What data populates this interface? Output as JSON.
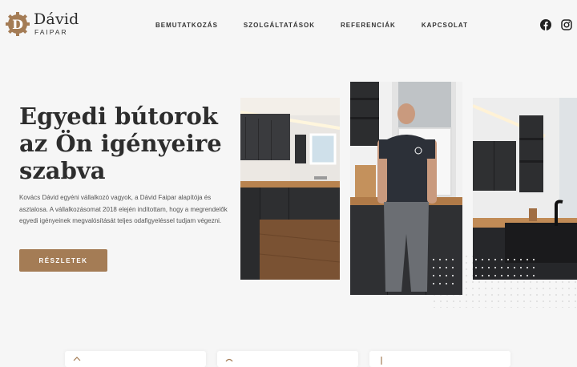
{
  "brand": {
    "initial": "D",
    "name": "Dávid",
    "subtitle": "FAIPAR"
  },
  "nav": [
    {
      "label": "BEMUTATKOZÁS"
    },
    {
      "label": "SZOLGÁLTATÁSOK"
    },
    {
      "label": "REFERENCIÁK"
    },
    {
      "label": "KAPCSOLAT"
    }
  ],
  "social": {
    "facebook_icon": "facebook-icon",
    "instagram_icon": "instagram-icon"
  },
  "hero": {
    "title": "Egyedi bútorok az Ön igényeire szabva",
    "text": "Kovács Dávid egyéni vállalkozó vagyok, a Dávid Faipar alapítója és asztalosa. A vállalkozásomat 2018 elején indítottam, hogy a megrendelők egyedi igényeinek megvalósítását teljes odafigyeléssel tudjam végezni.",
    "button": "RÉSZLETEK"
  },
  "colors": {
    "accent": "#a47c55",
    "background": "#f6f6f6",
    "heading": "#2d2d2d"
  }
}
